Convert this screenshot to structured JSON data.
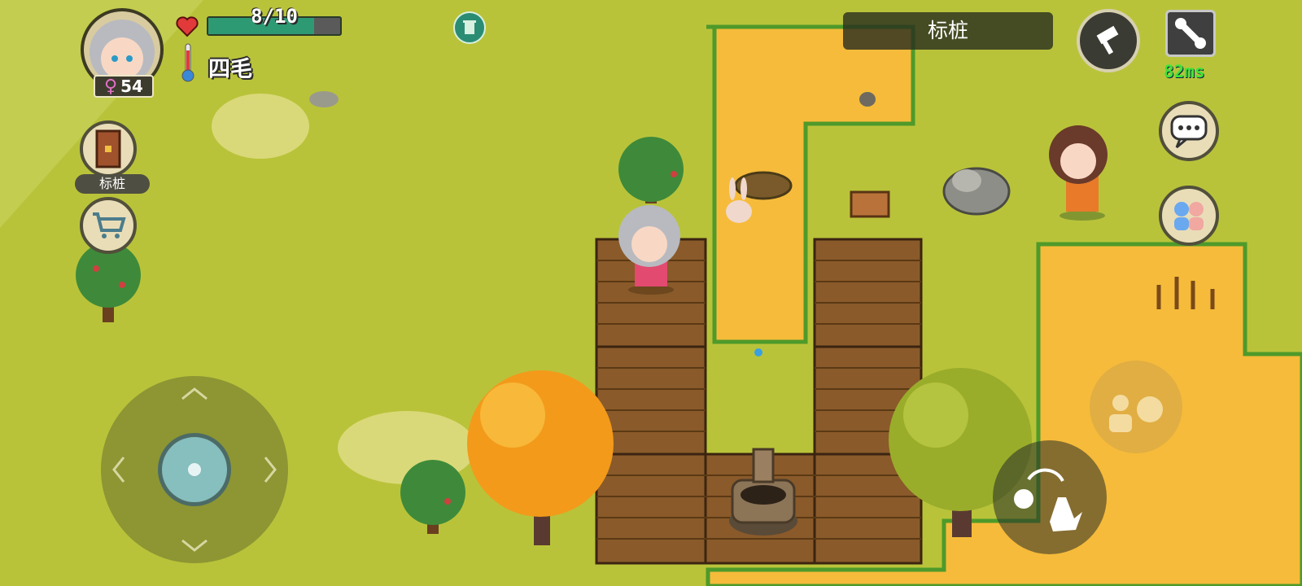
{
  "player": {
    "hp_text": "8/10",
    "hp_fraction": 0.8,
    "name": "四毛",
    "gender_icon": "female-symbol-icon",
    "age": "54"
  },
  "side_menu": {
    "signpost_label": "标桩"
  },
  "location": {
    "title": "标桩"
  },
  "network": {
    "ping": "82ms"
  },
  "colors": {
    "grass": "#b9c33a",
    "sand": "#f6bb3a",
    "wood": "#8a5a2a",
    "hp_fill": "#2e9a74",
    "ping": "#3ee33a"
  }
}
